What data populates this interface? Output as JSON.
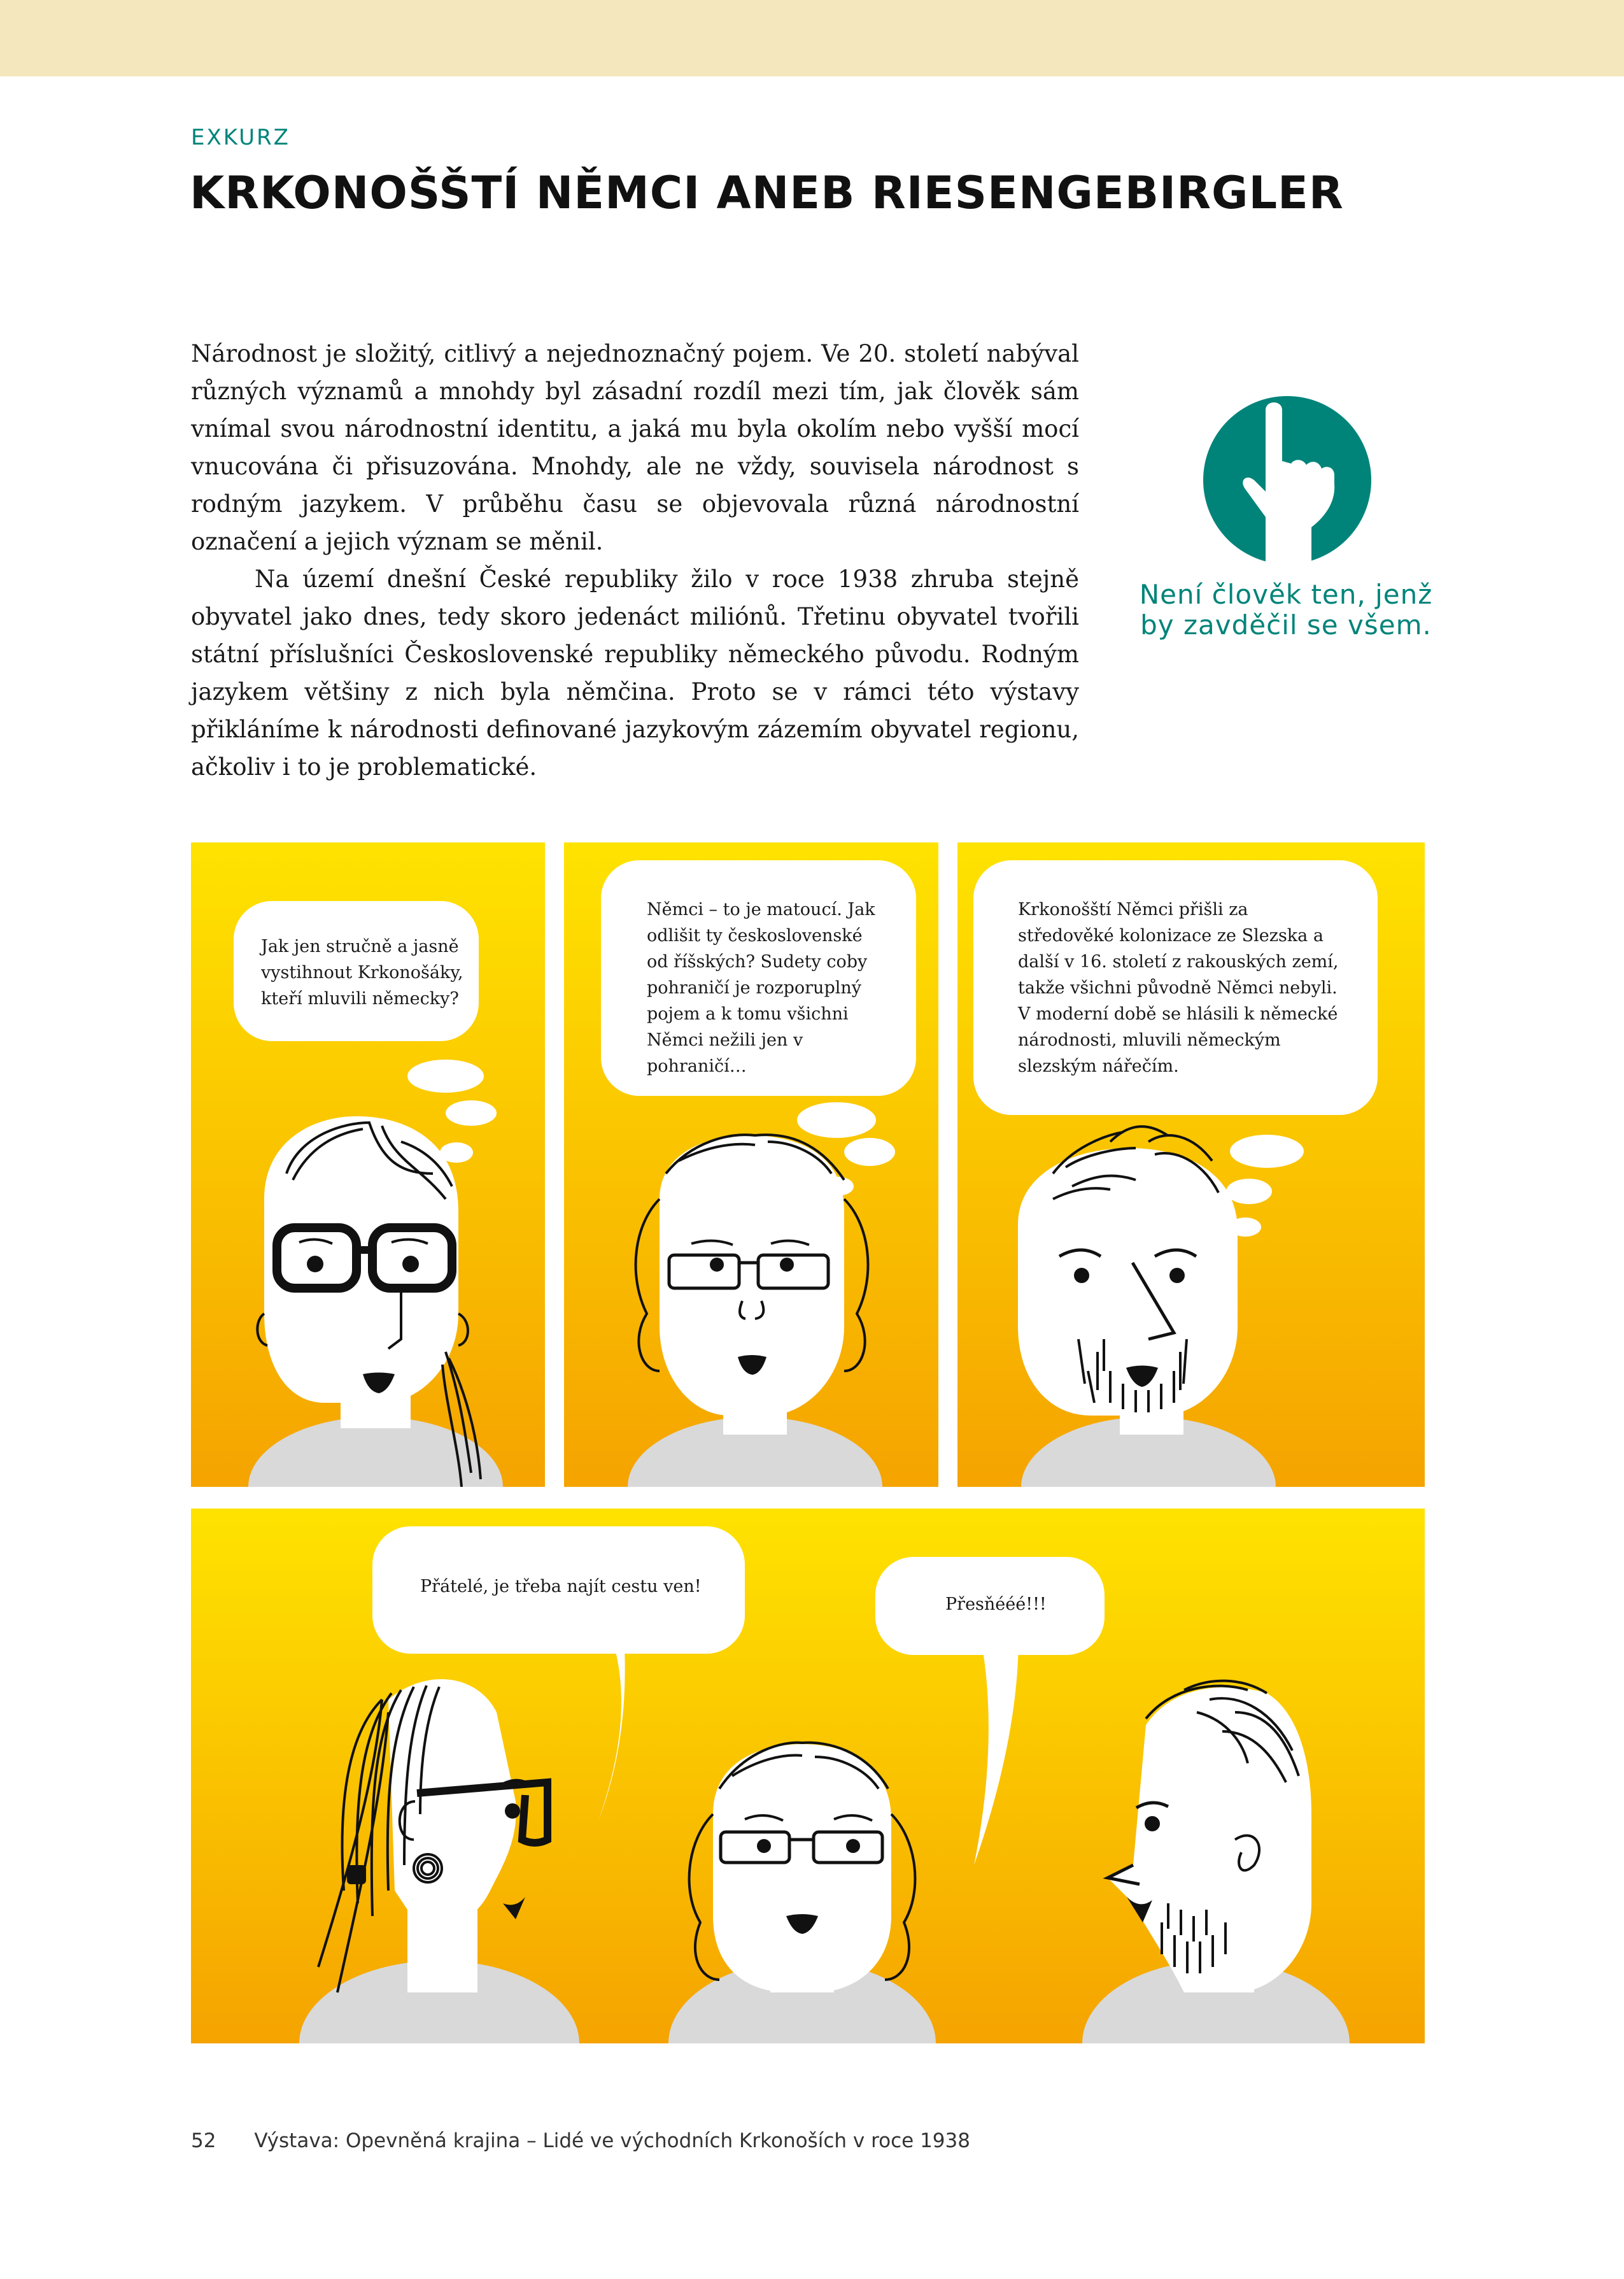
{
  "header": {
    "kicker": "EXKURZ",
    "title": "KRKONOŠŠTÍ NĚMCI ANEB RIESENGEBIRGLER"
  },
  "body": {
    "paragraph_1": "Národnost je složitý, citlivý a nejednoznačný pojem. Ve 20. století nabýval různých významů a mnohdy byl zásadní rozdíl mezi tím, jak člověk sám vnímal svou národnostní identitu, a jaká mu byla okolím nebo vyšší mocí vnucována či přisuzována. Mnohdy, ale ne vždy, souvisela národnost s rodným jazykem. V průběhu času se objevovala různá národnostní označení a jejich význam se měnil.",
    "paragraph_2": "Na území dnešní České republiky žilo v roce 1938 zhruba stejně obyvatel jako dnes, tedy skoro jedenáct miliónů. Třetinu obyvatel tvořili státní příslušníci Československé republiky německého původu. Rodným jazykem většiny z nich byla němčina. Proto se v rámci této výstavy přikláníme k národnosti definované jazykovým zázemím obyvatel regionu, ačkoliv i to je problematické."
  },
  "sidebar": {
    "icon": "pointing-hand-icon",
    "quote": "Není člověk ten, jenž by zavděčil se všem.",
    "accent_color": "#00847a"
  },
  "comic": {
    "panel_1": {
      "speech": "Jak jen stručně a jasně vystihnout Krkonošáky, kteří mluvili německy?"
    },
    "panel_2": {
      "speech": "Němci – to je matoucí. Jak odlišit ty československé od říšských? Sudety coby pohraničí je rozporuplný pojem a k tomu všichni Němci nežili jen v pohraničí…"
    },
    "panel_3": {
      "speech": "Krkonošští Němci přišli za středověké kolonizace ze Slezska a další v 16. století z rakouských zemí, takže všichni původně Němci nebyli. V moderní době se hlásili k německé národnosti, mluvili německým slezským nářečím."
    },
    "panel_4": {
      "speech_left": "Přátelé, je třeba najít cestu ven!",
      "speech_right": "Přesňééé!!!"
    },
    "colors": {
      "yellow": "#ffe000",
      "orange": "#f6a000",
      "shirt": "#d9d9d9"
    }
  },
  "footer": {
    "page_number": "52",
    "text": "Výstava: Opevněná krajina – Lidé ve východních Krkonoších v roce 1938"
  }
}
